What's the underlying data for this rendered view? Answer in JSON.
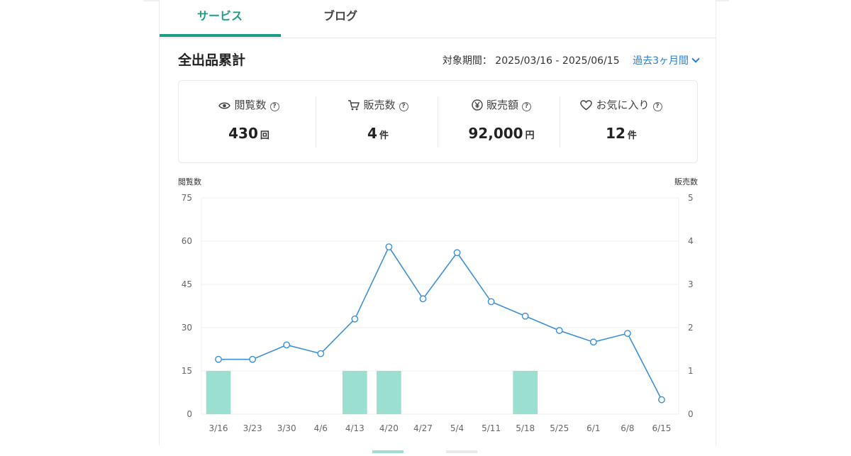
{
  "tabs": [
    {
      "label": "サービス",
      "active": true
    },
    {
      "label": "ブログ",
      "active": false
    }
  ],
  "section": {
    "title": "全出品累計",
    "period_label": "対象期間：",
    "period_range": "2025/03/16 - 2025/06/15",
    "period_select": "過去3ヶ月間"
  },
  "stats": [
    {
      "icon": "eye-icon",
      "label": "閲覧数",
      "value": "430",
      "unit": "回"
    },
    {
      "icon": "cart-icon",
      "label": "販売数",
      "value": "4",
      "unit": "件"
    },
    {
      "icon": "yen-icon",
      "label": "販売額",
      "value": "92,000",
      "unit": "円"
    },
    {
      "icon": "heart-icon",
      "label": "お気に入り",
      "value": "12",
      "unit": "件"
    }
  ],
  "help_glyph": "?",
  "colors": {
    "accent": "#1a9e85",
    "link": "#2a7fd4",
    "line": "#3d8fd6",
    "bar": "#9adfd0"
  },
  "chart_data": {
    "type": "bar+line",
    "y_left_label": "閲覧数",
    "y_right_label": "販売数",
    "categories": [
      "3/16",
      "3/23",
      "3/30",
      "4/6",
      "4/13",
      "4/20",
      "4/27",
      "5/4",
      "5/11",
      "5/18",
      "5/25",
      "6/1",
      "6/8",
      "6/15"
    ],
    "y_left_ticks": [
      0,
      15,
      30,
      45,
      60,
      75
    ],
    "y_right_ticks": [
      0,
      1,
      2,
      3,
      4,
      5
    ],
    "y_left_lim": [
      0,
      75
    ],
    "y_right_lim": [
      0,
      5
    ],
    "series": [
      {
        "name": "閲覧数",
        "type": "line",
        "axis": "left",
        "values": [
          19,
          19,
          24,
          21,
          33,
          58,
          40,
          56,
          39,
          34,
          29,
          25,
          28,
          5
        ]
      },
      {
        "name": "販売数",
        "type": "bar",
        "axis": "right",
        "values": [
          1,
          0,
          0,
          0,
          1,
          1,
          0,
          0,
          0,
          1,
          0,
          0,
          0,
          0
        ]
      }
    ],
    "grid": true
  }
}
